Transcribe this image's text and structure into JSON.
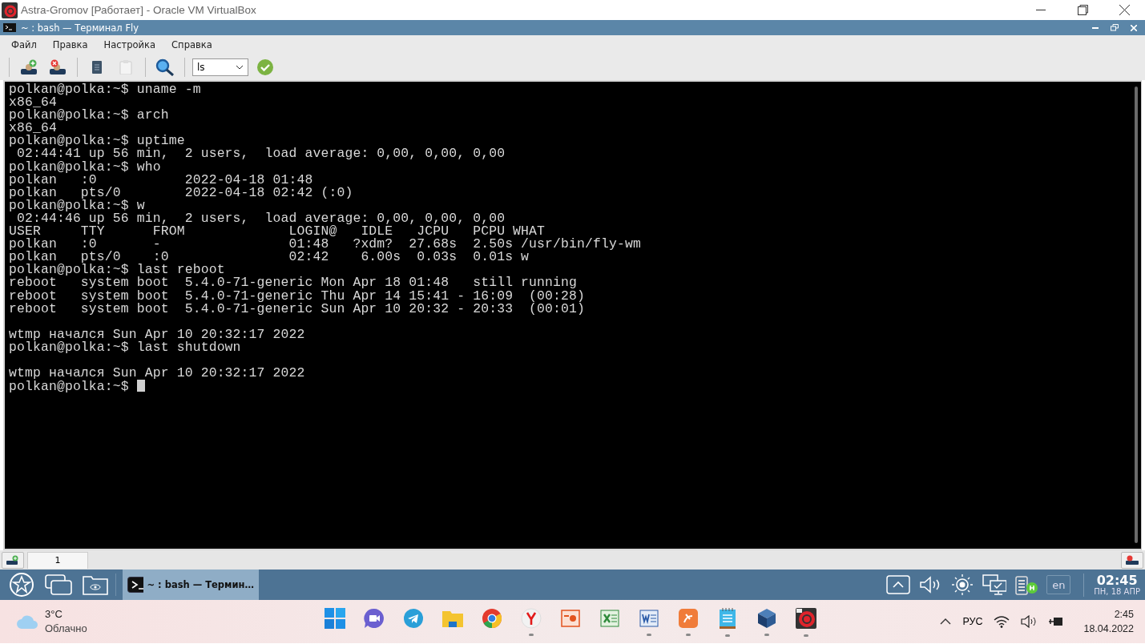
{
  "host_window": {
    "title": "Astra-Gromov [Работает] - Oracle VM VirtualBox"
  },
  "window": {
    "title": "~ : bash — Терминал Fly"
  },
  "menu": [
    "Файл",
    "Правка",
    "Настройка",
    "Справка"
  ],
  "toolbar": {
    "command": {
      "value": "ls"
    }
  },
  "terminal": {
    "lines": [
      {
        "kind": "text",
        "text": "polkan@polka:~$ uname -m"
      },
      {
        "kind": "text",
        "text": "x86_64"
      },
      {
        "kind": "text",
        "text": "polkan@polka:~$ arch"
      },
      {
        "kind": "text",
        "text": "x86_64"
      },
      {
        "kind": "text",
        "text": "polkan@polka:~$ uptime"
      },
      {
        "kind": "text",
        "text": " 02:44:41 up 56 min,  2 users,  load average: 0,00, 0,00, 0,00"
      },
      {
        "kind": "text",
        "text": "polkan@polka:~$ who"
      },
      {
        "kind": "text",
        "text": "polkan   :0           2022-04-18 01:48"
      },
      {
        "kind": "text",
        "text": "polkan   pts/0        2022-04-18 02:42 (:0)"
      },
      {
        "kind": "text",
        "text": "polkan@polka:~$ w"
      },
      {
        "kind": "text",
        "text": " 02:44:46 up 56 min,  2 users,  load average: 0,00, 0,00, 0,00"
      },
      {
        "kind": "text",
        "text": "USER     TTY      FROM             LOGIN@   IDLE   JCPU   PCPU WHAT"
      },
      {
        "kind": "text",
        "text": "polkan   :0       -                01:48   ?xdm?  27.68s  2.50s /usr/bin/fly-wm"
      },
      {
        "kind": "text",
        "text": "polkan   pts/0    :0               02:42    6.00s  0.03s  0.01s w"
      },
      {
        "kind": "text",
        "text": "polkan@polka:~$ last reboot"
      },
      {
        "kind": "text",
        "text": "reboot   system boot  5.4.0-71-generic Mon Apr 18 01:48   still running"
      },
      {
        "kind": "text",
        "text": "reboot   system boot  5.4.0-71-generic Thu Apr 14 15:41 - 16:09  (00:28)"
      },
      {
        "kind": "text",
        "text": "reboot   system boot  5.4.0-71-generic Sun Apr 10 20:32 - 20:33  (00:01)"
      },
      {
        "kind": "blank"
      },
      {
        "kind": "text",
        "text": "wtmp начался Sun Apr 10 20:32:17 2022"
      },
      {
        "kind": "text",
        "text": "polkan@polka:~$ last shutdown"
      },
      {
        "kind": "blank"
      },
      {
        "kind": "text",
        "text": "wtmp начался Sun Apr 10 20:32:17 2022"
      },
      {
        "kind": "prompt",
        "text": "polkan@polka:~$ "
      }
    ]
  },
  "terminal_tabs": [
    {
      "label": "1",
      "selected": true
    }
  ],
  "fly_taskbar": {
    "tasks": [
      {
        "label": "~ : bash — Термин…",
        "selected": true
      }
    ],
    "layout": "en",
    "time": "02:45",
    "date": "ПН, 18 АПР"
  },
  "win_taskbar": {
    "weather": {
      "temp": "3°C",
      "desc": "Облачно"
    },
    "apps": [
      {
        "kind": "start",
        "running": false
      },
      {
        "kind": "meet",
        "running": false
      },
      {
        "kind": "telegram",
        "running": false
      },
      {
        "kind": "folder",
        "running": false
      },
      {
        "kind": "chrome",
        "running": false
      },
      {
        "kind": "yandex",
        "running": true
      },
      {
        "kind": "slides",
        "running": false
      },
      {
        "kind": "sheet",
        "running": false
      },
      {
        "kind": "doc",
        "running": true
      },
      {
        "kind": "orange",
        "running": true
      },
      {
        "kind": "notepad",
        "running": true
      },
      {
        "kind": "cube",
        "running": true
      },
      {
        "kind": "swirl",
        "running": true
      }
    ],
    "lang": "РУС",
    "time": "2:45",
    "date": "18.04.2022"
  }
}
